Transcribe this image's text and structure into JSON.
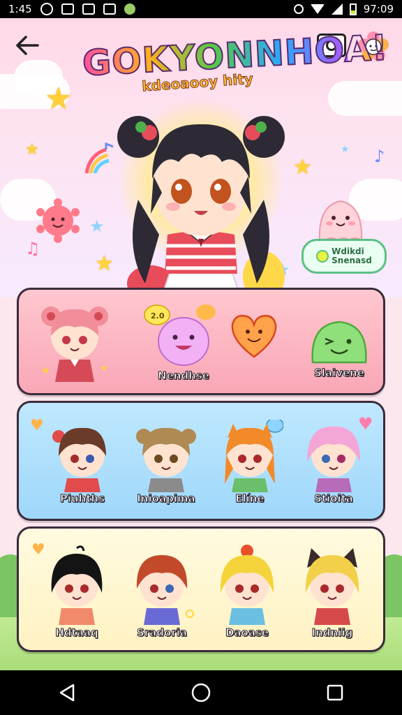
{
  "status_bar": {
    "time_left": "1:45",
    "time_right": "97:09"
  },
  "header": {
    "back_icon": "arrow-left-icon",
    "camera_icon": "camera-icon",
    "flower_icon": "flower-icon",
    "logo_title": "GOKYONNHOA!",
    "logo_subtitle": "kdeoaooy hity"
  },
  "hero": {
    "bubble_line1": "Wdikdi",
    "bubble_line2": "Snenasd"
  },
  "panels": {
    "pets": [
      {
        "label": "",
        "hair": "#f28e9a",
        "outfit": "#d64a57"
      },
      {
        "label": "Nendhse",
        "color": "#f2b0f5"
      },
      {
        "label": "",
        "color": "#ffa24a"
      },
      {
        "label": "Slaivene",
        "color": "#8fe07a"
      }
    ],
    "pets_badge": "2.0",
    "characters_row2": [
      {
        "label": "Piuhths",
        "hair": "#6b3b2a",
        "outfit": "#e24b4b"
      },
      {
        "label": "Inioapima",
        "hair": "#b08a53",
        "outfit": "#8b8b8b"
      },
      {
        "label": "Elíne",
        "hair": "#f28a2a",
        "outfit": "#6bbf6b"
      },
      {
        "label": "Stioita",
        "hair": "#f4a6d7",
        "outfit": "#b86bb8"
      }
    ],
    "characters_row3": [
      {
        "label": "Hdtaaq",
        "hair": "#141414",
        "outfit": "#f08a6b"
      },
      {
        "label": "Sradoria",
        "hair": "#c24a2a",
        "outfit": "#6a6ad6"
      },
      {
        "label": "Daoase",
        "hair": "#f4d43a",
        "outfit": "#6bbfe0"
      },
      {
        "label": "Indniig",
        "hair": "#f2d04a",
        "outfit": "#d64a4a"
      }
    ]
  },
  "nav_bar": {
    "back": "back-triangle-icon",
    "home": "home-circle-icon",
    "recents": "recents-square-icon"
  },
  "colors": {
    "accent_pink": "#ff4fa0",
    "panel_pink": "#ffc7cf",
    "panel_blue": "#bfe8ff",
    "panel_yellow": "#fff2c3"
  }
}
